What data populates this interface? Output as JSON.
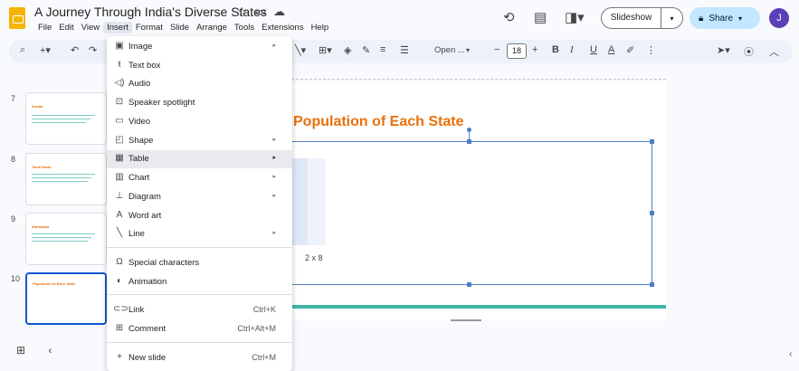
{
  "app": {
    "doc_title": "A Journey Through India's Diverse States",
    "menus": [
      "File",
      "Edit",
      "View",
      "Insert",
      "Format",
      "Slide",
      "Arrange",
      "Tools",
      "Extensions",
      "Help"
    ],
    "slideshow_label": "Slideshow",
    "share_label": "Share",
    "avatar_initial": "J"
  },
  "toolbar": {
    "font_name": "Open ...",
    "font_size": "18",
    "bold": "B",
    "italic": "I",
    "underline": "U",
    "text_color": "A"
  },
  "filmstrip": {
    "slides": [
      {
        "number": "7",
        "title": "Kerala"
      },
      {
        "number": "8",
        "title": "Tamil Nadu"
      },
      {
        "number": "9",
        "title": "Karnataka"
      },
      {
        "number": "10",
        "title": "Population of Each State"
      }
    ]
  },
  "slide": {
    "heading": "Population of Each State",
    "accent_color": "#e8710a",
    "bar_color": "#3fb4a5"
  },
  "insert_menu": {
    "items": [
      {
        "label": "Image",
        "icon": "image-icon",
        "submenu": true
      },
      {
        "label": "Text box",
        "icon": "text-box-icon"
      },
      {
        "label": "Audio",
        "icon": "audio-icon"
      },
      {
        "label": "Speaker spotlight",
        "icon": "speaker-spotlight-icon"
      },
      {
        "label": "Video",
        "icon": "video-icon"
      },
      {
        "label": "Shape",
        "icon": "shape-icon",
        "submenu": true
      },
      {
        "label": "Table",
        "icon": "table-icon",
        "submenu": true,
        "highlighted": true
      },
      {
        "label": "Chart",
        "icon": "chart-icon",
        "submenu": true
      },
      {
        "label": "Diagram",
        "icon": "diagram-icon",
        "submenu": true
      },
      {
        "label": "Word art",
        "icon": "word-art-icon"
      },
      {
        "label": "Line",
        "icon": "line-icon",
        "submenu": true
      },
      {
        "label": "Special characters",
        "icon": "omega-icon"
      },
      {
        "label": "Animation",
        "icon": "animation-icon"
      },
      {
        "label": "Link",
        "icon": "link-icon",
        "shortcut": "Ctrl+K"
      },
      {
        "label": "Comment",
        "icon": "comment-icon",
        "shortcut": "Ctrl+Alt+M"
      },
      {
        "label": "New slide",
        "icon": "new-slide-icon",
        "shortcut": "Ctrl+M"
      }
    ]
  },
  "table_submenu": {
    "size_label": "2 x 8"
  }
}
